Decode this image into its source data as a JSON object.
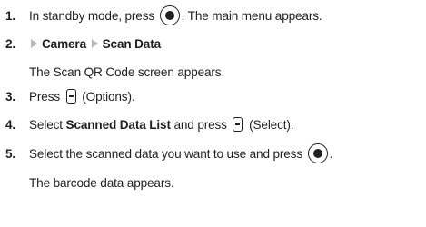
{
  "steps": [
    {
      "num": "1.",
      "text_a": "In standby mode, press",
      "text_b": ". The main menu appears."
    },
    {
      "num": "2.",
      "path_a": "Camera",
      "path_b": "Scan Data",
      "note": "The Scan QR Code screen appears."
    },
    {
      "num": "3.",
      "text_a": "Press",
      "text_b": "(Options)."
    },
    {
      "num": "4.",
      "text_a": "Select",
      "bold": "Scanned Data List",
      "text_b": "and press",
      "text_c": "(Select)."
    },
    {
      "num": "5.",
      "text_a": "Select the scanned data you want to use and press",
      "text_b": ".",
      "note": "The barcode data appears."
    }
  ]
}
